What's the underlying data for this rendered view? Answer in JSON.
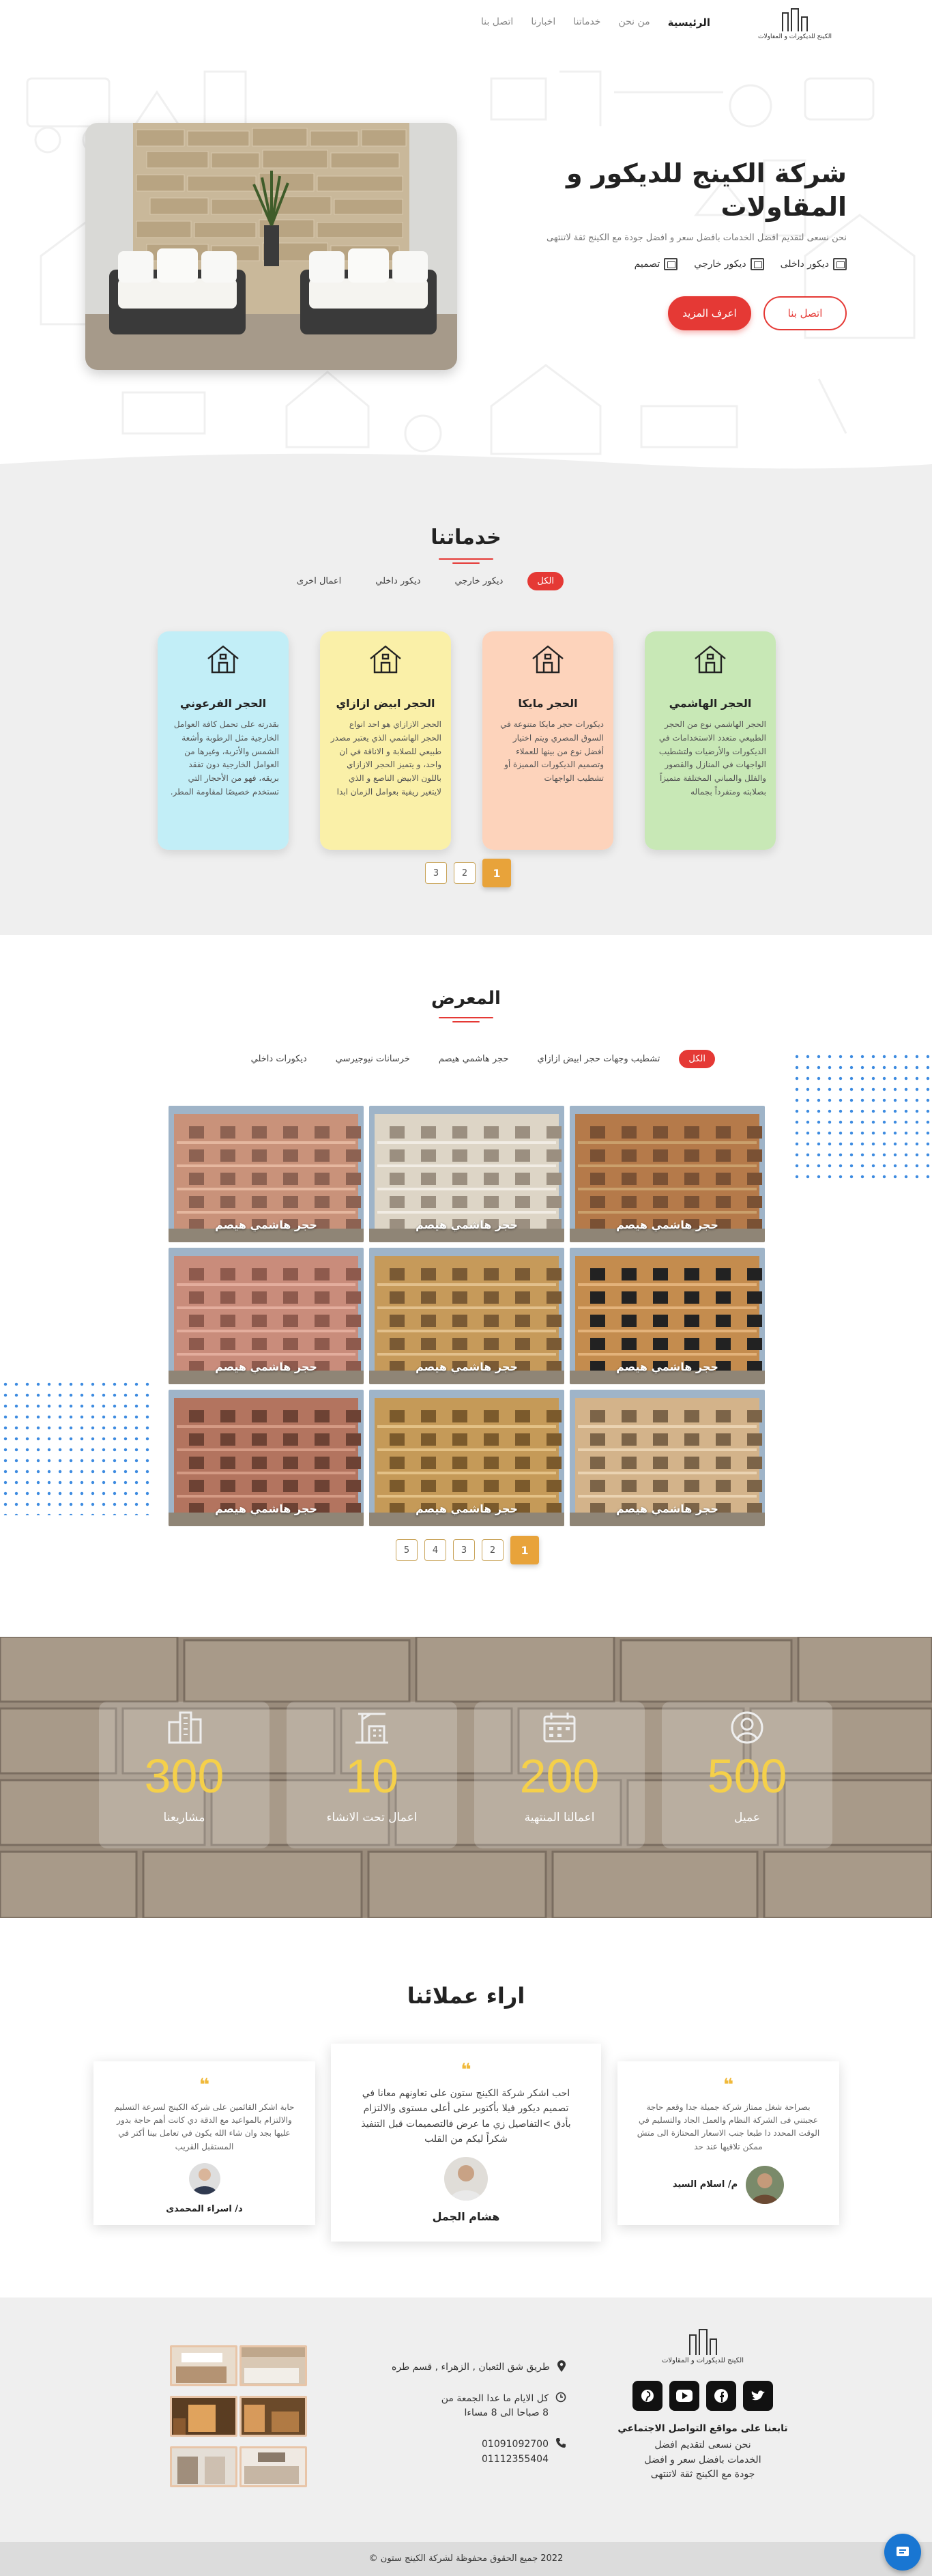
{
  "nav": {
    "items": [
      {
        "label": "الرئيسية"
      },
      {
        "label": "من نحن"
      },
      {
        "label": "خدماتنا"
      },
      {
        "label": "اخبارنا"
      },
      {
        "label": "اتصل بنا"
      }
    ],
    "logo_text": "الكينج للديكورات و المقاولات"
  },
  "hero": {
    "title": "شركة الكينج للديكور و المقاولات",
    "subtitle": "نحن نسعى لتقديم افضل الخدمات بافضل سعر و افضل جودة مع الكينج ثقة لاتنتهى",
    "tags": [
      {
        "label": "ديكور داخلى",
        "icon": "interior-icon"
      },
      {
        "label": "ديكور خارجي",
        "icon": "exterior-icon"
      },
      {
        "label": "تصميم",
        "icon": "design-icon"
      }
    ],
    "contact_button": "اتصل بنا",
    "more_button": "اعرف المزيد"
  },
  "services": {
    "title": "خدماتنا",
    "filters": [
      {
        "label": "الكل"
      },
      {
        "label": "ديكور خارجي"
      },
      {
        "label": "ديكور داخلي"
      },
      {
        "label": "اعمال اخرى"
      }
    ],
    "cards": [
      {
        "title": "الحجر الهاشمي",
        "desc": "الحجر الهاشمي نوع من الحجر الطبيعي متعدد الاستخدامات في الديكورات والأرضيات ولتشطيب الواجهات في المنازل والقصور والفلل والمباني المختلفة متميزاً بصلابته ومتفرداً بجماله",
        "color": "#c8e8b6"
      },
      {
        "title": "الحجر مايكا",
        "desc": "ديكورات حجر مايكا متنوعة في السوق المصري ويتم اختيار أفضل نوع من بينها للعملاء وتصميم الديكورات المميزة أو تشطيب الواجهات",
        "color": "#fdd3bb"
      },
      {
        "title": "الحجر ابيض ازازاي",
        "desc": "الحجر الازازاي هو احد انواع الحجر الهاشمي الذي يعتبر مصدر طبيعي للصلابة و الاناقة في ان واحد، و يتميز الحجر الازازاي باللون الابيض الناصع و الذي لايتغير ريفية بعوامل الزمان ابدا",
        "color": "#faf0a8"
      },
      {
        "title": "الحجر الفرعوني",
        "desc": "بقدرته على تحمل كافة العوامل الخارجية مثل الرطوبة وأشعة الشمس والأتربة، وغيرها من العوامل الخارجية دون تفقد بريقه، فهو من الأحجار التي تستخدم خصيصًا لمقاومة المطر.",
        "color": "#c2eef7"
      }
    ],
    "pages": [
      "1",
      "2",
      "3"
    ]
  },
  "gallery": {
    "title": "المعرض",
    "filters": [
      {
        "label": "الكل"
      },
      {
        "label": "تشطيب وجهات حجر ابيض ازازاي"
      },
      {
        "label": "حجر هاشمي هيصم"
      },
      {
        "label": "خرسانات نيوجيرسي"
      },
      {
        "label": "ديكورات داخلي"
      }
    ],
    "items": [
      {
        "caption": "حجر هاشمي هيصم"
      },
      {
        "caption": "حجر هاشمي هيصم"
      },
      {
        "caption": "حجر هاشمي هيصم"
      },
      {
        "caption": "حجر هاشمي هيصم"
      },
      {
        "caption": "حجر هاشمي هيصم"
      },
      {
        "caption": "حجر هاشمي هيصم"
      },
      {
        "caption": "حجر هاشمي هيصم"
      },
      {
        "caption": "حجر هاشمي هيصم"
      },
      {
        "caption": "حجر هاشمي هيصم"
      }
    ],
    "pages": [
      "1",
      "2",
      "3",
      "4",
      "5"
    ]
  },
  "stats": [
    {
      "value": "500",
      "label": "عميل",
      "icon": "user-icon"
    },
    {
      "value": "200",
      "label": "اعمالنا المنتهية",
      "icon": "calendar-icon"
    },
    {
      "value": "10",
      "label": "اعمال تحت الانشاء",
      "icon": "construction-icon"
    },
    {
      "value": "300",
      "label": "مشاريعنا",
      "icon": "buildings-icon"
    }
  ],
  "testimonials": {
    "title": "اراء عملائنا",
    "items": [
      {
        "text": "بصراحة شغل ممتاز شركة جميلة جدا وقعم حاجة عجبتني فى الشركة النظام والعمل الجاد والتسليم في الوقت المحدد دا طبعا جنب الاسعار المحتازة الى متش ممكن تلاقيها عند حد",
        "name": "م/ اسلام السيد"
      },
      {
        "text": "احب اشكر شركة الكينج ستون على تعاونهم معانا في تصميم ديكور فيلا بأكتوبر على أعلى مستوى والالتزام بأدق >التفاصيل زي ما عرض فالتصميمات قبل التنفيذ شكراً ليكم من القلب",
        "name": "هشام الجمل"
      },
      {
        "text": "حابة اشكر القائمين على شركة الكينج لسرعة التسليم والالتزام بالمواعيد مع الدقة دي كانت أهم حاجة بدور عليها بجد وان شاء الله يكون في تعامل بينا أكتر في المستقبل القريب",
        "name": "د/ اسراء المحمدى"
      }
    ]
  },
  "footer": {
    "logo_text": "الكينج للديكورات و المقاولات",
    "follow": "تابعنا على مواقع التواصل الاجتماعي",
    "about": "نحن نسعى لتقديم افضل الخدمات بافضل سعر و افضل جودة مع الكينج ثقة لاتنتهى",
    "address": "طريق شق الثعبان , الزهراء , قسم طره",
    "hours": "كل الايام ما عدا الجمعة من 8 صباحا الى 8 مساءا",
    "phone1": "01091092700",
    "phone2": "01112355404",
    "social": [
      "twitter-icon",
      "facebook-icon",
      "youtube-icon",
      "pinterest-icon"
    ]
  },
  "copyright": "2022 جميع الحقوق محفوظة لشركة الكينج ستون ©"
}
